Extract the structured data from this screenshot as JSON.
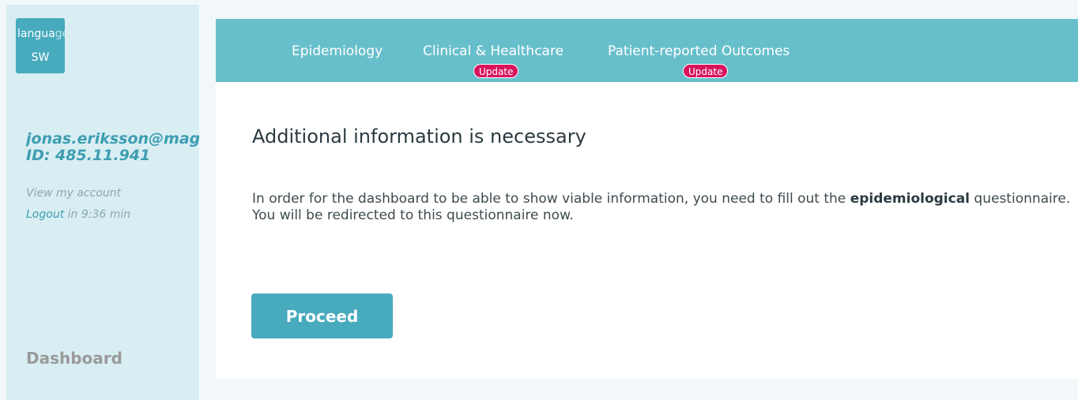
{
  "sidebar": {
    "language_button": {
      "line1_visible": "langua",
      "line1_faded": "ge.en-",
      "line2": "SW"
    },
    "user_email": "jonas.eriksson@magotec.com",
    "user_id": "ID: 485.11.941",
    "view_account": "View my account",
    "logout_link": "Logout",
    "logout_timer": " in 9:36 min",
    "dashboard": "Dashboard"
  },
  "topnav": {
    "items": [
      {
        "label": "Epidemiology"
      },
      {
        "label": "Clinical & Healthcare",
        "badge": "Update"
      },
      {
        "label": "Patient-reported Outcomes",
        "badge": "Update"
      }
    ]
  },
  "main": {
    "title": "Additional information is necessary",
    "body_before": "In order for the dashboard to be able to show viable information, you need to fill out the ",
    "body_bold": "epidemiological",
    "body_after": " questionnaire. You will be redirected to this questionnaire now.",
    "proceed_label": "Proceed"
  },
  "colors": {
    "accent": "#48aabd",
    "nav_bar": "#68bfcc",
    "sidebar_bg": "#d8eef3",
    "badge": "#d9145e"
  }
}
